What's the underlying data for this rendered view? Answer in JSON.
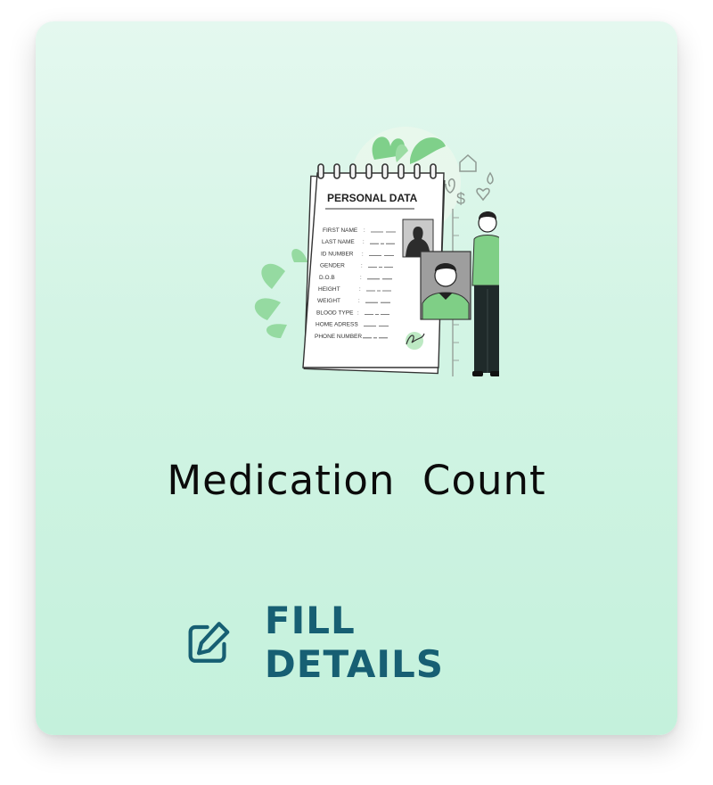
{
  "card": {
    "title": "Medication  Count",
    "action_label": "FILL DETAILS",
    "action_icon": "edit-icon"
  },
  "illustration": {
    "heading": "PERSONAL DATA",
    "fields": [
      "FIRST NAME",
      "LAST NAME",
      "ID NUMBER",
      "GENDER",
      "D.O.B",
      "HEIGHT",
      "WEIGHT",
      "BLOOD TYPE",
      "HOME ADRESS",
      "PHONE NUMBER"
    ]
  },
  "colors": {
    "card_top": "#e4f8ef",
    "card_bottom": "#c4f1dc",
    "accent_green": "#6ecf7e",
    "action_text": "#175f73",
    "title_text": "#0b0b0b"
  }
}
